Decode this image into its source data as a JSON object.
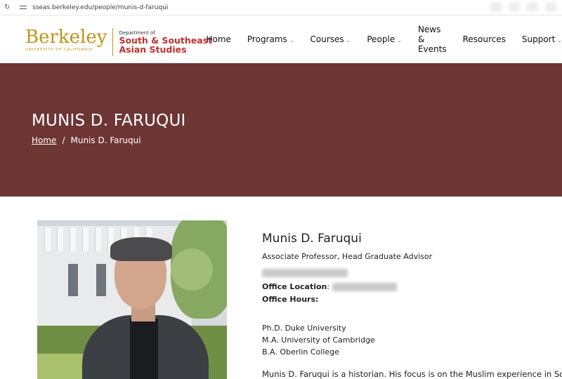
{
  "browser": {
    "url": "sseas.berkeley.edu/people/munis-d-faruqui"
  },
  "header": {
    "logo": {
      "berkeley": "Berkeley",
      "university": "UNIVERSITY OF CALIFORNIA",
      "department_prefix": "Department of",
      "department_line1": "South & Southeast",
      "department_line2": "Asian Studies"
    },
    "nav": [
      {
        "label": "Home",
        "has_dropdown": false
      },
      {
        "label": "Programs",
        "has_dropdown": true
      },
      {
        "label": "Courses",
        "has_dropdown": true
      },
      {
        "label": "People",
        "has_dropdown": true
      },
      {
        "label": "News & Events",
        "has_dropdown": false
      },
      {
        "label": "Resources",
        "has_dropdown": false
      },
      {
        "label": "Support",
        "has_dropdown": true
      }
    ],
    "dropdown_glyph": "⌄"
  },
  "hero": {
    "title": "MUNIS D. FARUQUI",
    "breadcrumb": {
      "home": "Home",
      "separator": "/",
      "current": "Munis D. Faruqui"
    },
    "background": "#6E3535"
  },
  "profile": {
    "name": "Munis D. Faruqui",
    "position": "Associate Professor, Head Graduate Advisor",
    "office_location_label": "Office Location",
    "office_location_separator": ":",
    "office_hours_label": "Office Hours:",
    "degrees": [
      "Ph.D. Duke University",
      "M.A. University of Cambridge",
      "B.A. Oberlin College"
    ],
    "bio_start": "Munis D. Faruqui is a historian. His focus is on the Muslim experience in South Asia,"
  },
  "colors": {
    "gold": "#C69214",
    "red": "#C0312B",
    "hero": "#6E3535"
  }
}
